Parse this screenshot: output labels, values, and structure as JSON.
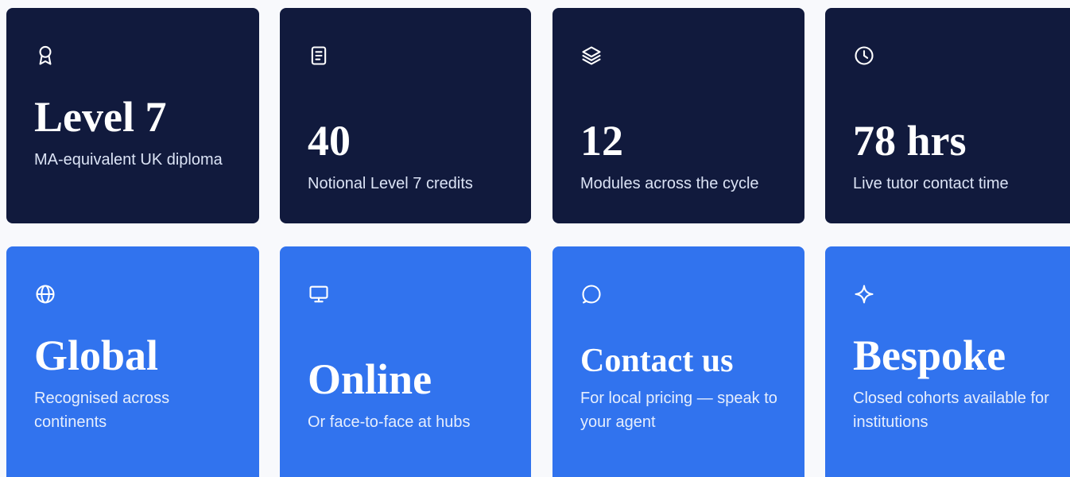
{
  "stats": [
    {
      "icon": "award-icon",
      "value": "Level 7",
      "desc": "MA-equivalent UK diploma"
    },
    {
      "icon": "document-icon",
      "value": "40",
      "desc": "Notional Level 7 credits"
    },
    {
      "icon": "layers-icon",
      "value": "12",
      "desc": "Modules across the cycle"
    },
    {
      "icon": "clock-icon",
      "value": "78 hrs",
      "desc": "Live tutor contact time"
    }
  ],
  "features": [
    {
      "icon": "globe-icon",
      "value": "Global",
      "desc": "Recognised across continents"
    },
    {
      "icon": "monitor-icon",
      "value": "Online",
      "desc": "Or face-to-face at hubs"
    },
    {
      "icon": "chat-bubble-icon",
      "value": "Contact us",
      "desc": "For local pricing — speak to your agent"
    },
    {
      "icon": "sparkle-icon",
      "value": "Bespoke",
      "desc": "Closed cohorts available for institutions"
    }
  ],
  "colors": {
    "dark_card": "#111a3d",
    "blue_card": "#3173ee"
  }
}
